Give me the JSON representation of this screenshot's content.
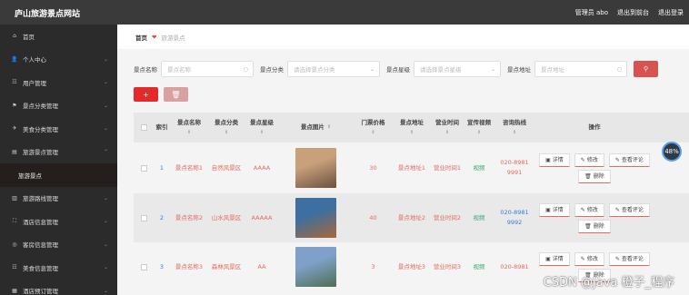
{
  "topbar": {
    "title": "庐山旅游景点网站",
    "admin": "管理员 abo",
    "back": "退出到前台",
    "logout": "退出登录"
  },
  "sidebar": [
    {
      "icon": "⌂",
      "label": "首页",
      "chev": ""
    },
    {
      "icon": "👤",
      "label": "个人中心",
      "chev": "⌄"
    },
    {
      "icon": "☷",
      "label": "用户管理",
      "chev": "⌄"
    },
    {
      "icon": "⚑",
      "label": "景点分类管理",
      "chev": "⌄"
    },
    {
      "icon": "✈",
      "label": "美食分类管理",
      "chev": "⌄"
    },
    {
      "icon": "▤",
      "label": "旅游景点管理",
      "chev": "⌃"
    },
    {
      "icon": "",
      "label": "旅游景点",
      "chev": ""
    },
    {
      "icon": "▥",
      "label": "旅游路线管理",
      "chev": "⌄"
    },
    {
      "icon": "⛶",
      "label": "酒店信息管理",
      "chev": "⌄"
    },
    {
      "icon": "◎",
      "label": "客房信息管理",
      "chev": "⌄"
    },
    {
      "icon": "☷",
      "label": "美食信息管理",
      "chev": "⌄"
    },
    {
      "icon": "▦",
      "label": "酒店预订管理",
      "chev": "⌄"
    }
  ],
  "breadcrumb": {
    "home": "首页",
    "current": "旅游景点"
  },
  "search": {
    "name_label": "景点名称",
    "name_ph": "景点名称",
    "cat_label": "景点分类",
    "cat_ph": "请选择景点分类",
    "lvl_label": "景点星级",
    "lvl_ph": "请选择景点星级",
    "addr_label": "景点地址",
    "addr_ph": "景点地址"
  },
  "buttons": {
    "add": "+",
    "delete": "🗑"
  },
  "table": {
    "headers": [
      "索引",
      "景点名称",
      "景点分类",
      "景点星级",
      "景点图片",
      "门票价格",
      "景点地址",
      "营业时间",
      "宣传视频",
      "咨询热线",
      "操作"
    ],
    "rows": [
      {
        "idx": "1",
        "name": "景点名称1",
        "cat": "自然风景区",
        "lvl": "AAAA",
        "price": "30",
        "addr": "景点地址1",
        "time": "营业时间1",
        "video": "视频",
        "tel": "020-8981 9991",
        "c1": "#c8a07a",
        "c2": "#6b5140"
      },
      {
        "idx": "2",
        "name": "景点名称2",
        "cat": "山水风景区",
        "lvl": "AAAAA",
        "price": "40",
        "addr": "景点地址2",
        "time": "营业时间2",
        "video": "视频",
        "tel": "020-8981 9992",
        "c1": "#3d6fa0",
        "c2": "#a6683a"
      },
      {
        "idx": "3",
        "name": "景点名称3",
        "cat": "森林风景区",
        "lvl": "AA",
        "price": "3",
        "addr": "景点地址3",
        "time": "营业时间3",
        "video": "视频",
        "tel": "020-8981",
        "c1": "#7fa0c8",
        "c2": "#4f6f52"
      }
    ],
    "ops": {
      "detail": "详情",
      "edit": "修改",
      "review": "查看评论",
      "remove": "删除"
    }
  },
  "badge": "48%",
  "watermark": "CSDN @Java  橙子_程序",
  "colors": {
    "accent": "#d8534f",
    "sidebar": "#2b2b2b",
    "topbar": "#3a3a3a"
  }
}
